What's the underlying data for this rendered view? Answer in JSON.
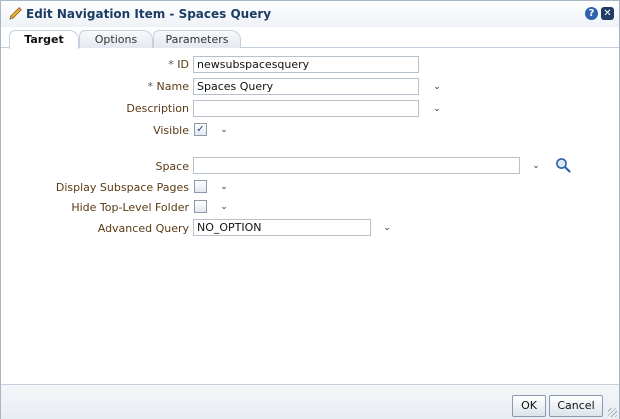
{
  "dialog": {
    "title": "Edit Navigation Item - Spaces Query",
    "help_glyph": "?",
    "close_glyph": "✕"
  },
  "tabs": [
    {
      "label": "Target",
      "active": true
    },
    {
      "label": "Options",
      "active": false
    },
    {
      "label": "Parameters",
      "active": false
    }
  ],
  "form": {
    "id": {
      "required": "*",
      "label": "ID",
      "value": "newsubspacesquery"
    },
    "name": {
      "required": "*",
      "label": "Name",
      "value": "Spaces Query"
    },
    "description": {
      "label": "Description",
      "value": ""
    },
    "visible": {
      "label": "Visible",
      "checked": true,
      "check_glyph": "✓"
    },
    "space": {
      "label": "Space",
      "value": ""
    },
    "display_subspace_pages": {
      "label": "Display Subspace Pages",
      "checked": false
    },
    "hide_top_level_folder": {
      "label": "Hide Top-Level Folder",
      "checked": false
    },
    "advanced_query": {
      "label": "Advanced Query",
      "value": "NO_OPTION"
    }
  },
  "icons": {
    "chevron_glyph": "⌄",
    "pencil": "pencil-icon",
    "search": "search-icon",
    "help": "help-icon",
    "close": "close-icon"
  },
  "footer": {
    "ok_label": "OK",
    "cancel_label": "Cancel"
  },
  "colors": {
    "title_text": "#1c3c66",
    "label_text": "#5a3a15",
    "help_bg": "#2f62ad",
    "close_bg": "#1f3c66",
    "check": "#1d4a93"
  }
}
